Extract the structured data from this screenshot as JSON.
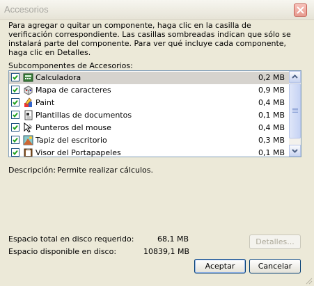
{
  "window": {
    "title": "Accesorios"
  },
  "intro": "Para agregar o quitar un componente, haga clic en la casilla de verificación correspondiente. Las casillas sombreadas indican que sólo se instalará parte del componente. Para ver qué incluye cada componente, haga clic en Detalles.",
  "subcomponents_label": "Subcomponentes de Accesorios:",
  "items": [
    {
      "name": "Calculadora",
      "size": "0,2 MB",
      "checked": true,
      "icon": "calculator-icon"
    },
    {
      "name": "Mapa de caracteres",
      "size": "0,9 MB",
      "checked": true,
      "icon": "character-map-icon"
    },
    {
      "name": "Paint",
      "size": "0,4 MB",
      "checked": true,
      "icon": "paint-icon"
    },
    {
      "name": "Plantillas de documentos",
      "size": "0,1 MB",
      "checked": true,
      "icon": "document-template-icon"
    },
    {
      "name": "Punteros del mouse",
      "size": "0,4 MB",
      "checked": true,
      "icon": "mouse-pointer-icon"
    },
    {
      "name": "Tapiz del escritorio",
      "size": "0,3 MB",
      "checked": true,
      "icon": "wallpaper-icon"
    },
    {
      "name": "Visor del Portapapeles",
      "size": "0,1 MB",
      "checked": true,
      "icon": "clipboard-icon"
    }
  ],
  "description": {
    "label": "Descripción:",
    "value": "Permite realizar cálculos."
  },
  "disk": {
    "required_label": "Espacio total en disco requerido:",
    "required_value": "68,1 MB",
    "available_label": "Espacio disponible en disco:",
    "available_value": "10839,1 MB"
  },
  "buttons": {
    "details": "Detalles...",
    "accept": "Aceptar",
    "cancel": "Cancelar"
  }
}
